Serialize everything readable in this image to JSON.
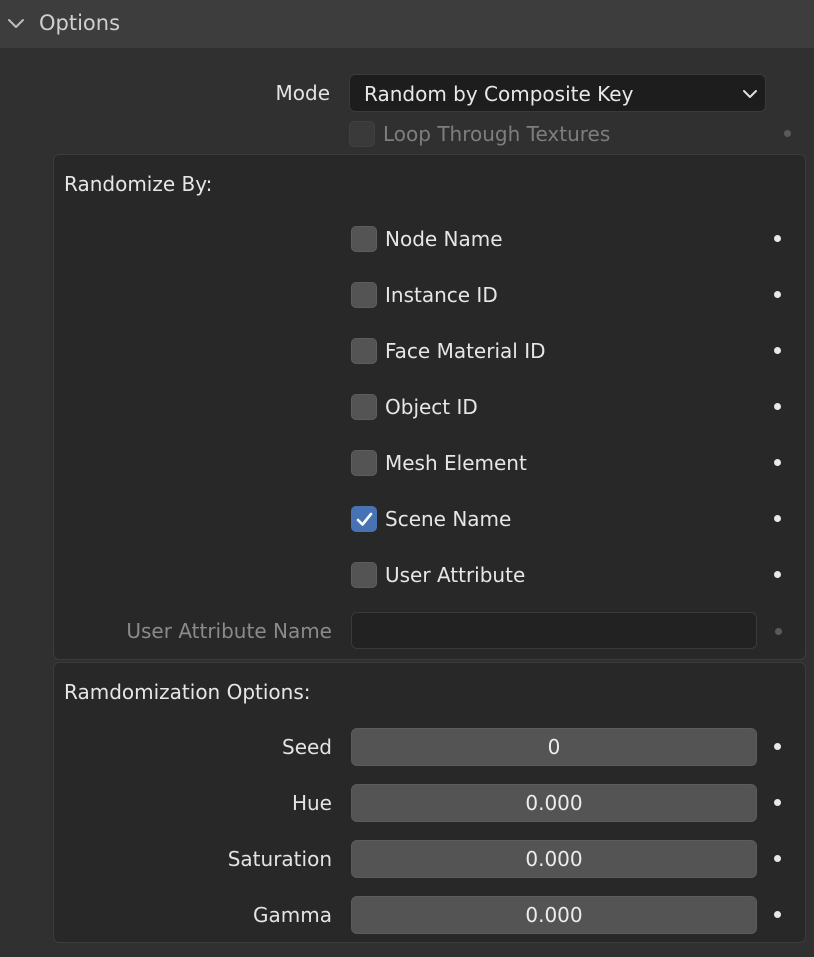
{
  "header": {
    "title": "Options"
  },
  "mode": {
    "label": "Mode",
    "value": "Random by Composite Key"
  },
  "loop_textures": {
    "label": "Loop Through Textures",
    "checked": false,
    "enabled": false
  },
  "randomize_by": {
    "title": "Randomize By:",
    "items": [
      {
        "label": "Node Name",
        "checked": false
      },
      {
        "label": "Instance ID",
        "checked": false
      },
      {
        "label": "Face Material ID",
        "checked": false
      },
      {
        "label": "Object ID",
        "checked": false
      },
      {
        "label": "Mesh Element",
        "checked": false
      },
      {
        "label": "Scene Name",
        "checked": true
      },
      {
        "label": "User Attribute",
        "checked": false
      }
    ],
    "user_attribute_name": {
      "label": "User Attribute Name",
      "value": ""
    }
  },
  "randomization_options": {
    "title": "Ramdomization Options:",
    "fields": [
      {
        "label": "Seed",
        "value": "0"
      },
      {
        "label": "Hue",
        "value": "0.000"
      },
      {
        "label": "Saturation",
        "value": "0.000"
      },
      {
        "label": "Gamma",
        "value": "0.000"
      }
    ]
  },
  "colors": {
    "accent": "#4772b3",
    "panel_bg": "#282828",
    "window_bg": "#303030"
  }
}
